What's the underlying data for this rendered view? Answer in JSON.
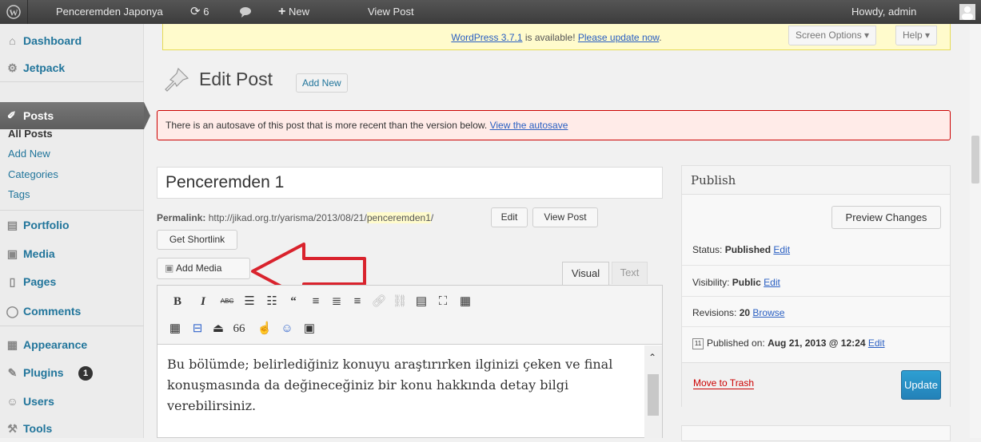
{
  "adminbar": {
    "site_name": "Penceremden Japonya",
    "updates_count": "6",
    "new_label": "New",
    "view_post_label": "View Post",
    "howdy": "Howdy, admin"
  },
  "sidebar": {
    "items": [
      {
        "icon": "dashboard-icon",
        "label": "Dashboard"
      },
      {
        "icon": "jetpack-icon",
        "label": "Jetpack"
      },
      {
        "icon": "pin-icon",
        "label": "Posts"
      },
      {
        "icon": "portfolio-icon",
        "label": "Portfolio"
      },
      {
        "icon": "media-icon",
        "label": "Media"
      },
      {
        "icon": "pages-icon",
        "label": "Pages"
      },
      {
        "icon": "comments-icon",
        "label": "Comments"
      },
      {
        "icon": "appearance-icon",
        "label": "Appearance"
      },
      {
        "icon": "plugins-icon",
        "label": "Plugins",
        "badge": "1"
      },
      {
        "icon": "users-icon",
        "label": "Users"
      },
      {
        "icon": "tools-icon",
        "label": "Tools"
      }
    ],
    "posts_sub": [
      "All Posts",
      "Add New",
      "Categories",
      "Tags"
    ]
  },
  "notice": {
    "update_link": "WordPress 3.7.1",
    "update_text": " is available! ",
    "update_now": "Please update now",
    "update_end": ".",
    "screen_options": "Screen Options ▾",
    "help": "Help ▾"
  },
  "page": {
    "title": "Edit Post",
    "add_new": "Add New",
    "autosave_text": "There is an autosave of this post that is more recent than the version below. ",
    "autosave_link": "View the autosave"
  },
  "post": {
    "title": "Penceremden 1",
    "permalink_label": "Permalink:",
    "permalink_base": " http://jikad.org.tr/yarisma/2013/08/21/",
    "permalink_slug": "penceremden1",
    "permalink_end": "/",
    "edit_btn": "Edit",
    "view_post_btn": "View Post",
    "shortlink_btn": "Get Shortlink",
    "add_media": "Add Media",
    "tab_visual": "Visual",
    "tab_text": "Text",
    "content": "Bu bölümde; belirlediğiniz konuyu araştırırken ilginizi çeken ve final konuşmasında da değineceğiniz bir konu hakkında detay bilgi verebilirsiniz."
  },
  "publish": {
    "title": "Publish",
    "preview": "Preview Changes",
    "status_label": "Status: ",
    "status_value": "Published",
    "visibility_label": "Visibility: ",
    "visibility_value": "Public",
    "revisions_label": "Revisions: ",
    "revisions_value": "20",
    "browse": "Browse",
    "published_label": "Published on: ",
    "published_value": "Aug 21, 2013 @ 12:24",
    "edit": "Edit",
    "trash": "Move to Trash",
    "update": "Update"
  },
  "colors": {
    "accent": "#21759b",
    "arrow": "#d9232d",
    "update_button": "#2381b8"
  }
}
